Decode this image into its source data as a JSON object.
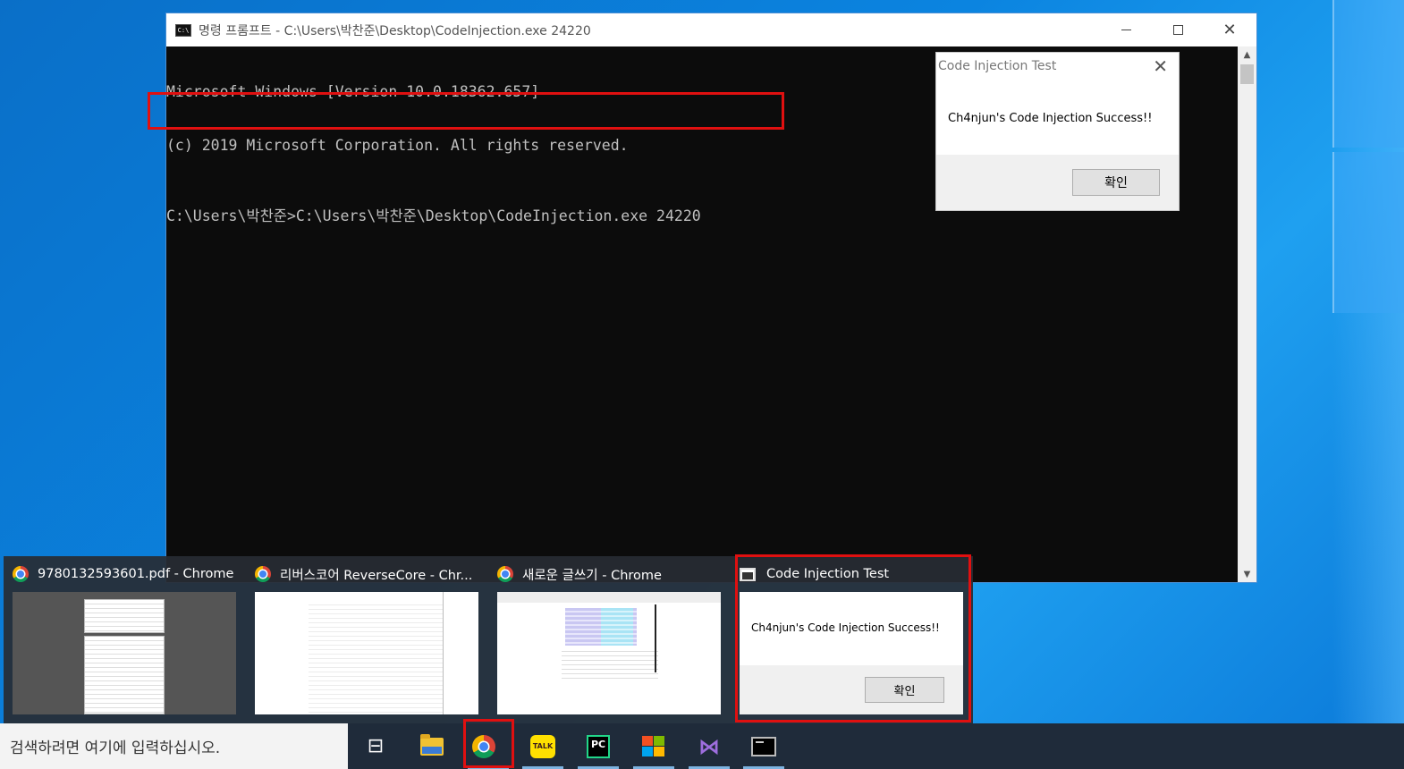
{
  "cmd_window": {
    "title": "명령 프롬프트 - C:\\Users\\박찬준\\Desktop\\CodeInjection.exe  24220",
    "icon_text": "C:\\",
    "lines": [
      "Microsoft Windows [Version 10.0.18362.657]",
      "(c) 2019 Microsoft Corporation. All rights reserved."
    ],
    "prompt_line": "C:\\Users\\박찬준>C:\\Users\\박찬준\\Desktop\\CodeInjection.exe 24220"
  },
  "message_box": {
    "title": "Code Injection Test",
    "message": "Ch4njun's Code Injection Success!!",
    "ok_label": "확인"
  },
  "thumbnails": [
    {
      "title": "9780132593601.pdf - Chrome",
      "icon": "chrome-icon"
    },
    {
      "title": "리버스코어 ReverseCore - Chr...",
      "icon": "chrome-icon"
    },
    {
      "title": "새로운 글쓰기 - Chrome",
      "icon": "chrome-icon"
    },
    {
      "title": "Code Injection Test",
      "icon": "cmd-icon",
      "message": "Ch4njun's Code Injection Success!!",
      "ok_label": "확인"
    }
  ],
  "taskbar": {
    "search_placeholder": "검색하려면 여기에 입력하십시오.",
    "talk_label": "TALK",
    "pc_label": "PC",
    "vs_label": "⋈"
  },
  "colors": {
    "highlight": "#e01010",
    "desktop": "#0b84e0",
    "taskbar": "#1f2b3a"
  }
}
